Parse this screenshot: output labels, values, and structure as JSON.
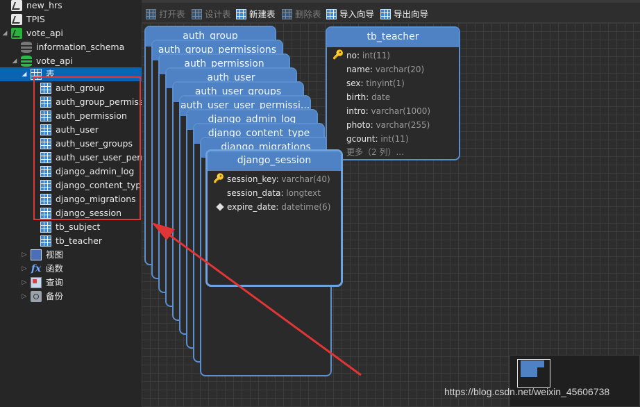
{
  "sidebar": {
    "connections": [
      {
        "label": "new_hrs"
      },
      {
        "label": "TPIS"
      },
      {
        "label": "vote_api"
      }
    ],
    "databases": [
      {
        "label": "information_schema"
      },
      {
        "label": "vote_api"
      }
    ],
    "tables_node": {
      "label": "表"
    },
    "tables": [
      {
        "label": "auth_group"
      },
      {
        "label": "auth_group_permissions"
      },
      {
        "label": "auth_permission"
      },
      {
        "label": "auth_user"
      },
      {
        "label": "auth_user_groups"
      },
      {
        "label": "auth_user_user_permissions"
      },
      {
        "label": "django_admin_log"
      },
      {
        "label": "django_content_type"
      },
      {
        "label": "django_migrations"
      },
      {
        "label": "django_session"
      },
      {
        "label": "tb_subject"
      },
      {
        "label": "tb_teacher"
      }
    ],
    "other_nodes": [
      {
        "label": "视图",
        "icon": "view-icon"
      },
      {
        "label": "函数",
        "icon": "function-icon"
      },
      {
        "label": "查询",
        "icon": "query-icon"
      },
      {
        "label": "备份",
        "icon": "backup-icon"
      }
    ]
  },
  "toolbar": {
    "buttons": [
      {
        "label": "打开表",
        "enabled": false,
        "icon": "open-table-icon"
      },
      {
        "label": "设计表",
        "enabled": false,
        "icon": "design-table-icon"
      },
      {
        "label": "新建表",
        "enabled": true,
        "icon": "new-table-icon"
      },
      {
        "label": "删除表",
        "enabled": false,
        "icon": "delete-table-icon"
      },
      {
        "label": "导入向导",
        "enabled": true,
        "icon": "import-icon"
      },
      {
        "label": "导出向导",
        "enabled": true,
        "icon": "export-icon"
      }
    ]
  },
  "diagram": {
    "stacked_card_titles": [
      "auth_group",
      "auth_group_permissions",
      "auth_permission",
      "auth_user",
      "auth_user_groups",
      "auth_user_user_permissi...",
      "django_admin_log",
      "django_content_type",
      "django_migrations"
    ],
    "django_session": {
      "title": "django_session",
      "fields": [
        {
          "name": "session_key",
          "type": "varchar(40)",
          "marker": "key"
        },
        {
          "name": "session_data",
          "type": "longtext",
          "marker": ""
        },
        {
          "name": "expire_date",
          "type": "datetime(6)",
          "marker": "index"
        }
      ]
    },
    "tb_teacher": {
      "title": "tb_teacher",
      "fields": [
        {
          "name": "no",
          "type": "int(11)",
          "marker": "key"
        },
        {
          "name": "name",
          "type": "varchar(20)",
          "marker": ""
        },
        {
          "name": "sex",
          "type": "tinyint(1)",
          "marker": ""
        },
        {
          "name": "birth",
          "type": "date",
          "marker": ""
        },
        {
          "name": "intro",
          "type": "varchar(1000)",
          "marker": ""
        },
        {
          "name": "photo",
          "type": "varchar(255)",
          "marker": ""
        },
        {
          "name": "gcount",
          "type": "int(11)",
          "marker": ""
        }
      ],
      "more": "更多（2 列）..."
    }
  },
  "watermark": "https://blog.csdn.net/weixin_45606738",
  "colors": {
    "accent": "#0a64b4",
    "card_header": "#4e82c4",
    "annotation_red": "#e23636"
  }
}
